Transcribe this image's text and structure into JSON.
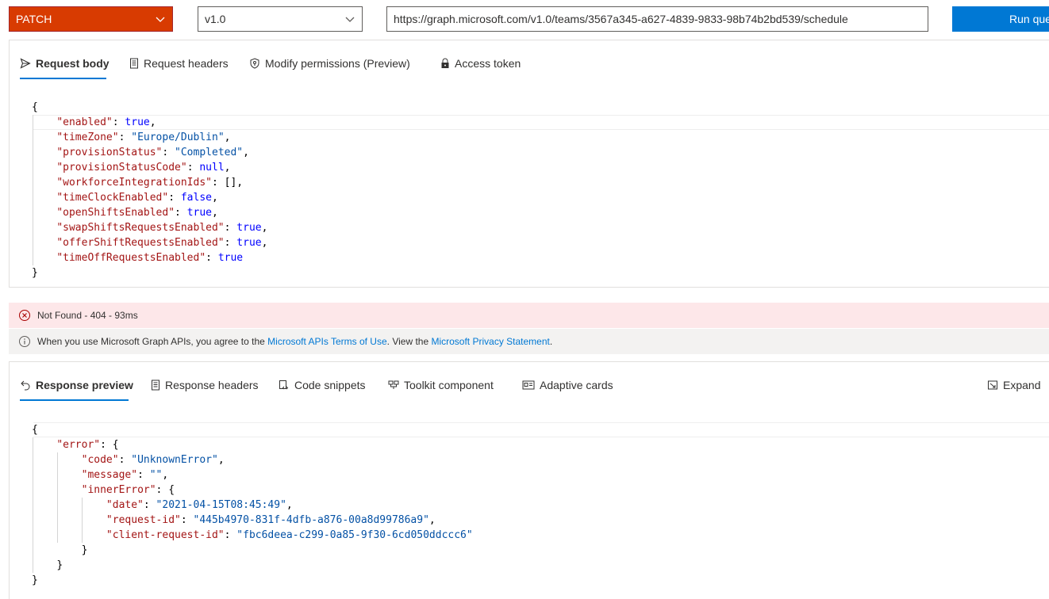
{
  "toolbar": {
    "method": "PATCH",
    "version": "v1.0",
    "url": "https://graph.microsoft.com/v1.0/teams/3567a345-a627-4839-9833-98b74b2bd539/schedule",
    "run_label": "Run que"
  },
  "request_tabs": [
    {
      "label": "Request body",
      "icon": "send-icon"
    },
    {
      "label": "Request headers",
      "icon": "document-icon"
    },
    {
      "label": "Modify permissions (Preview)",
      "icon": "shield-key-icon"
    },
    {
      "label": "Access token",
      "icon": "lock-icon"
    }
  ],
  "request_body": {
    "open": "{",
    "close": "}",
    "lines": [
      {
        "key": "enabled",
        "value": "true",
        "type": "kw",
        "comma": true
      },
      {
        "key": "timeZone",
        "value": "\"Europe/Dublin\"",
        "type": "str",
        "comma": true
      },
      {
        "key": "provisionStatus",
        "value": "\"Completed\"",
        "type": "str",
        "comma": true
      },
      {
        "key": "provisionStatusCode",
        "value": "null",
        "type": "kw",
        "comma": true
      },
      {
        "key": "workforceIntegrationIds",
        "value": "[]",
        "type": "plain",
        "comma": true
      },
      {
        "key": "timeClockEnabled",
        "value": "false",
        "type": "kw",
        "comma": true
      },
      {
        "key": "openShiftsEnabled",
        "value": "true",
        "type": "kw",
        "comma": true
      },
      {
        "key": "swapShiftsRequestsEnabled",
        "value": "true",
        "type": "kw",
        "comma": true
      },
      {
        "key": "offerShiftRequestsEnabled",
        "value": "true",
        "type": "kw",
        "comma": true
      },
      {
        "key": "timeOffRequestsEnabled",
        "value": "true",
        "type": "kw",
        "comma": false
      }
    ]
  },
  "status": {
    "error_text": "Not Found - 404 - 93ms",
    "info_prefix": "When you use Microsoft Graph APIs, you agree to the ",
    "info_link1": "Microsoft APIs Terms of Use",
    "info_middle": ". View the ",
    "info_link2": "Microsoft Privacy Statement",
    "info_suffix": "."
  },
  "response_tabs": [
    {
      "label": "Response preview",
      "icon": "undo-arrow-icon"
    },
    {
      "label": "Response headers",
      "icon": "document-icon"
    },
    {
      "label": "Code snippets",
      "icon": "code-snippet-icon"
    },
    {
      "label": "Toolkit component",
      "icon": "toolkit-icon"
    },
    {
      "label": "Adaptive cards",
      "icon": "card-icon"
    }
  ],
  "expand_label": "Expand",
  "response_body": {
    "lines": [
      {
        "indent": 0,
        "text": "{"
      },
      {
        "indent": 1,
        "key": "error",
        "rest": ": {"
      },
      {
        "indent": 2,
        "key": "code",
        "value": "\"UnknownError\"",
        "comma": true
      },
      {
        "indent": 2,
        "key": "message",
        "value": "\"\"",
        "comma": true
      },
      {
        "indent": 2,
        "key": "innerError",
        "rest": ": {"
      },
      {
        "indent": 3,
        "key": "date",
        "value": "\"2021-04-15T08:45:49\"",
        "comma": true
      },
      {
        "indent": 3,
        "key": "request-id",
        "value": "\"445b4970-831f-4dfb-a876-00a8d99786a9\"",
        "comma": true
      },
      {
        "indent": 3,
        "key": "client-request-id",
        "value": "\"fbc6deea-c299-0a85-9f30-6cd050ddccc6\"",
        "comma": false
      },
      {
        "indent": 2,
        "text": "}"
      },
      {
        "indent": 1,
        "text": "}"
      },
      {
        "indent": 0,
        "text": "}"
      }
    ]
  }
}
